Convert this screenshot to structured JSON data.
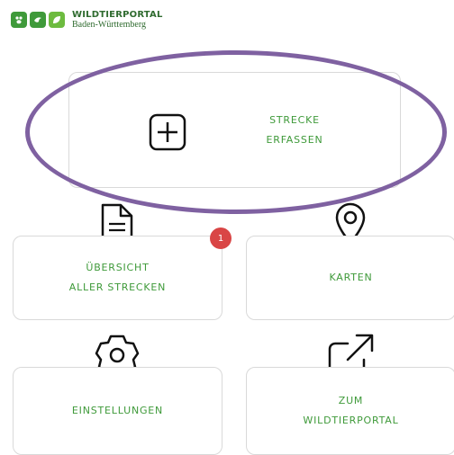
{
  "logo": {
    "title": "WILDTIERPORTAL",
    "subtitle": "Baden-Württemberg",
    "icon_names": [
      "paw-print-icon",
      "bird-icon",
      "leaf-icon"
    ],
    "brand_color": "#3f9a3a"
  },
  "tiles": {
    "add_route": {
      "line1": "STRECKE",
      "line2": "ERFASSEN",
      "icon": "plus-box-icon"
    },
    "overview": {
      "line1": "ÜBERSICHT",
      "line2": "ALLER STRECKEN",
      "icon": "document-icon",
      "badge": "1"
    },
    "maps": {
      "label": "KARTEN",
      "icon": "map-pin-icon"
    },
    "settings": {
      "label": "EINSTELLUNGEN",
      "icon": "gear-icon"
    },
    "portal": {
      "line1": "ZUM",
      "line2": "WILDTIERPORTAL",
      "icon": "external-link-icon"
    }
  },
  "colors": {
    "label_green": "#3f9a3a",
    "badge_red": "#d94545",
    "highlight_purple": "#7f61a1"
  }
}
